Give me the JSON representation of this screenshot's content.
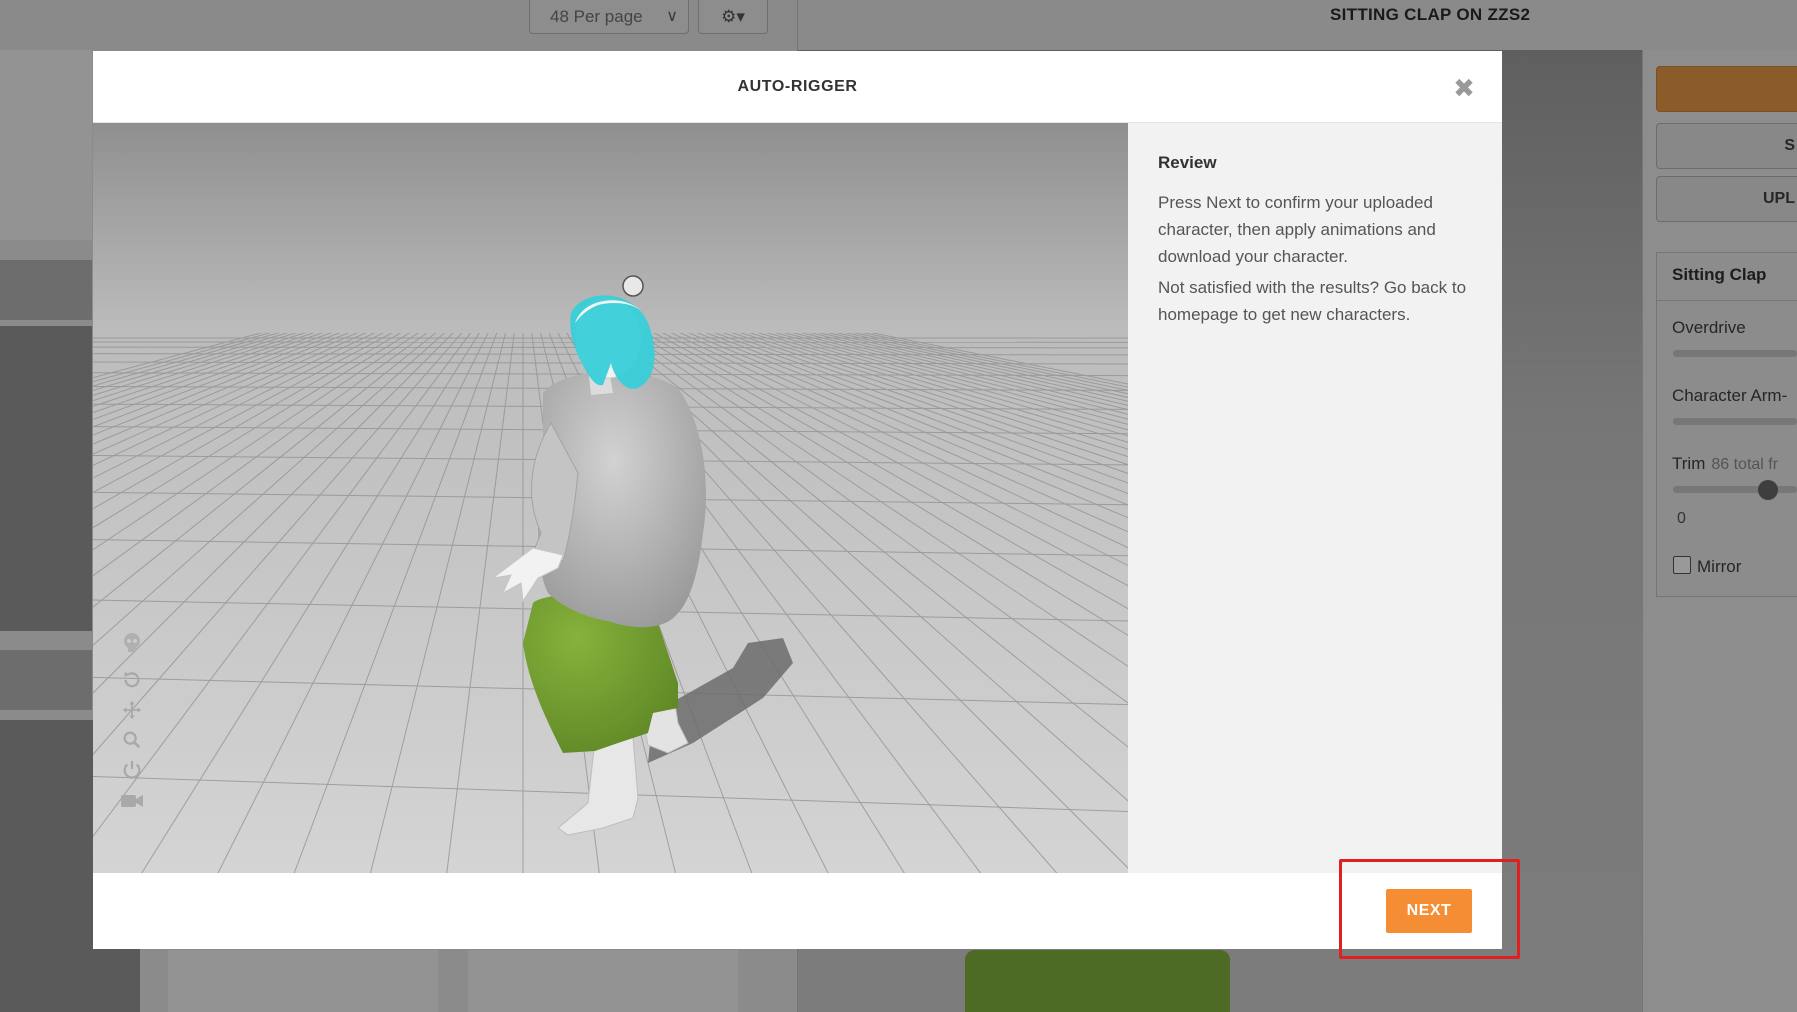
{
  "background": {
    "per_page_label": "48 Per page",
    "animation_title": "SITTING CLAP ON ZZS2",
    "right_panel": {
      "buttons": [
        "",
        "S",
        "UPL"
      ],
      "card_title": "Sitting Clap",
      "overdrive_label": "Overdrive",
      "arm_space_label": "Character Arm-",
      "trim_label": "Trim",
      "trim_frames": "86 total fr",
      "trim_start": "0",
      "mirror_label": "Mirror"
    }
  },
  "modal": {
    "title": "AUTO-RIGGER",
    "close_icon": "close-icon",
    "review": {
      "heading": "Review",
      "paragraph_1": "Press Next to confirm your uploaded character, then apply animations and download your character.",
      "paragraph_2": "Not satisfied with the results? Go back to homepage to get new characters."
    },
    "viewport_tools": [
      "skeleton-icon",
      "reset-icon",
      "pan-icon",
      "zoom-icon",
      "power-icon",
      "camera-icon"
    ],
    "next_label": "NEXT"
  },
  "colors": {
    "accent": "#f58d35",
    "highlight": "#e02020",
    "shirt": "#b9b9b9",
    "pants": "#6f9a2e",
    "hair": "#38cfd8"
  }
}
